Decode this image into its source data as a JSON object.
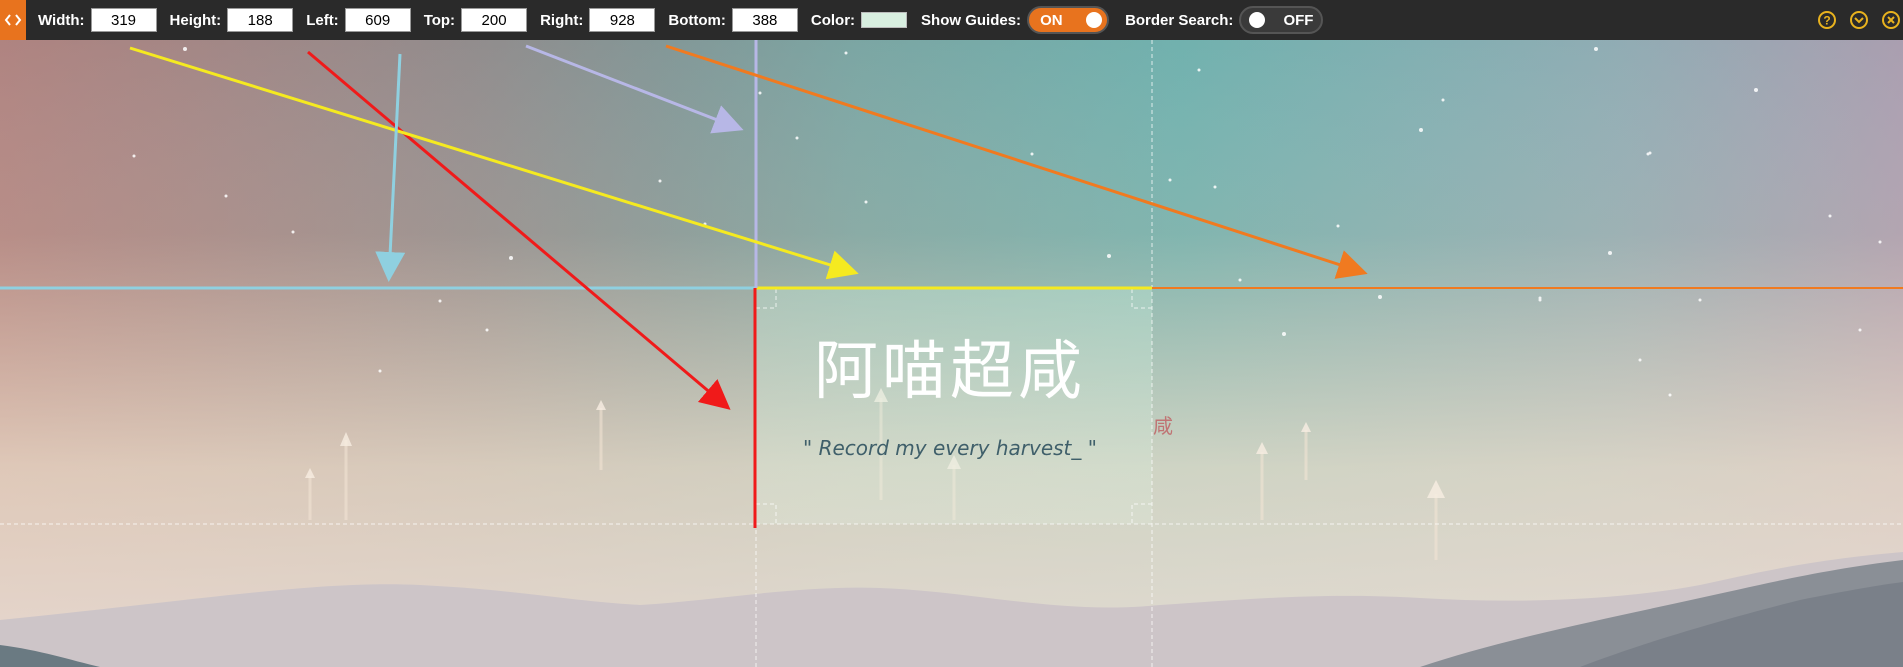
{
  "toolbar": {
    "width_label": "Width:",
    "width_value": "319",
    "height_label": "Height:",
    "height_value": "188",
    "left_label": "Left:",
    "left_value": "609",
    "top_label": "Top:",
    "top_value": "200",
    "right_label": "Right:",
    "right_value": "928",
    "bottom_label": "Bottom:",
    "bottom_value": "388",
    "color_label": "Color:",
    "color_value": "#d8efe0",
    "show_guides_label": "Show Guides:",
    "show_guides_state": "ON",
    "border_search_label": "Border Search:",
    "border_search_state": "OFF",
    "accent": "#e8731e",
    "icons": [
      "help-icon",
      "collapse-icon",
      "close-icon"
    ]
  },
  "page": {
    "title": "阿喵超咸",
    "subtitle": "\" Record my every harvest_ \"",
    "side_glyph": "咸"
  },
  "guide_colors": {
    "top": "#8fd0e0",
    "left": "#f01a1a",
    "right": "#b7b7e6",
    "bottom": "#f5ea20",
    "extra": "#f07a20"
  }
}
